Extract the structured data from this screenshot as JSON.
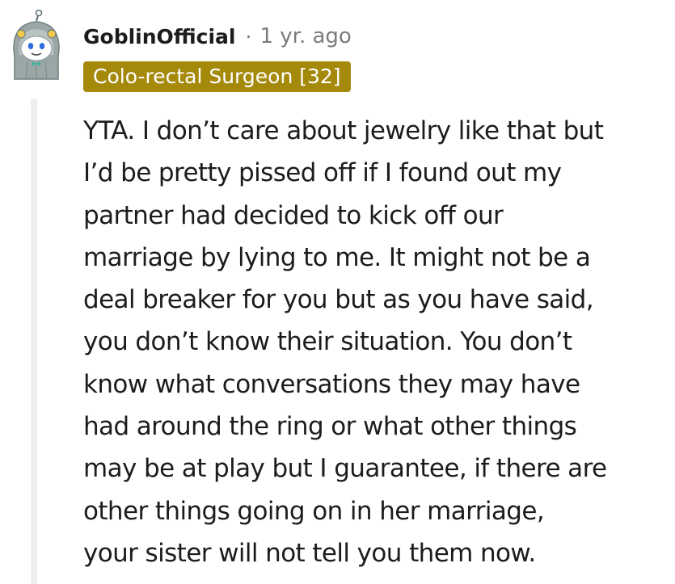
{
  "comment": {
    "author": "GoblinOfficial",
    "separator": "·",
    "timestamp": "1 yr. ago",
    "flair": "Colo-rectal Surgeon [32]",
    "flair_color": "#a4890b",
    "avatar_icon": "snoo-avatar-icon",
    "body_lines": [
      "YTA. I don’t care about jewelry like that but",
      "I’d be pretty pissed off if I found out my",
      "partner had decided to kick off our",
      "marriage by lying to me. It might not be a",
      "deal breaker for you but as you have said,",
      "you don’t know their situation. You don’t",
      "know what conversations they may have",
      "had around the ring or what other things",
      "may be at play but I guarantee, if there are",
      "other things going on in her marriage,",
      "your sister will not tell you them now."
    ]
  }
}
